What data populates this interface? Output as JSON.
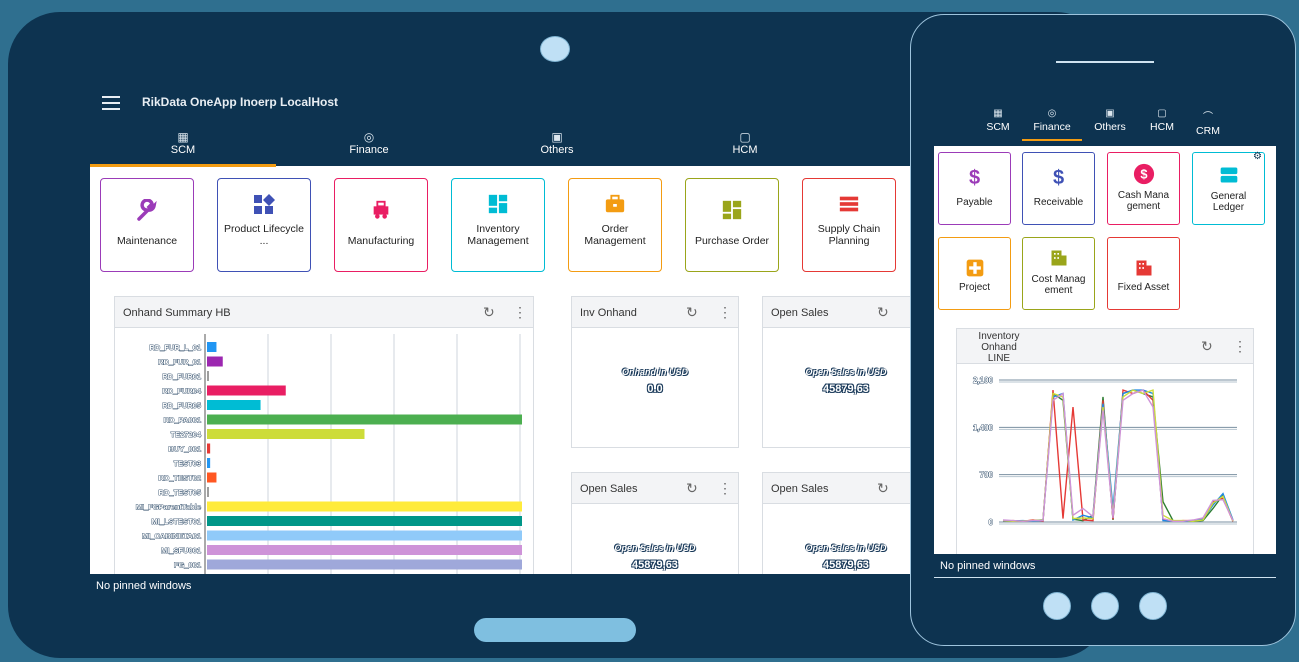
{
  "app": {
    "title": "RikData OneApp Inoerp LocalHost",
    "pinned": "No pinned windows"
  },
  "tabs": [
    {
      "label": "SCM",
      "icon": "building-icon"
    },
    {
      "label": "Finance",
      "icon": "globe-icon"
    },
    {
      "label": "Others",
      "icon": "others-icon"
    },
    {
      "label": "HCM",
      "icon": "person-icon"
    }
  ],
  "tiles": [
    {
      "label": "Maintenance",
      "color": "#9b3bb8",
      "icon": "wrench-icon"
    },
    {
      "label": "Product Lifecycle ...",
      "color": "#3f51b5",
      "icon": "shapes-icon"
    },
    {
      "label": "Manufacturing",
      "color": "#e91e63",
      "icon": "truck-icon"
    },
    {
      "label": "Inventory Management",
      "color": "#00bcd4",
      "icon": "grid-icon"
    },
    {
      "label": "Order Management",
      "color": "#f39c12",
      "icon": "briefcase-icon"
    },
    {
      "label": "Purchase Order",
      "color": "#9aa51a",
      "icon": "blocks-icon"
    },
    {
      "label": "Supply Chain Planning",
      "color": "#e53935",
      "icon": "bars-icon"
    }
  ],
  "onhand_panel": {
    "title": "Onhand Summary HB"
  },
  "kpis": [
    {
      "title": "Inv Onhand",
      "label": "Onhand in USD",
      "value": "0.0"
    },
    {
      "title": "Open Sales",
      "label": "Open Sales in USD",
      "value": "45879,63"
    },
    {
      "title": "Open Sales",
      "label": "Open Sales in USD",
      "value": "45879,63"
    },
    {
      "title": "Open Sales",
      "label": "Open Sales in USD",
      "value": "45879,63"
    }
  ],
  "chart_data": [
    {
      "type": "bar",
      "orientation": "horizontal",
      "title": "Onhand Summary HB",
      "categories": [
        "RD_FUR_L_01",
        "RD_FUR_01",
        "RD_FUR01",
        "RD_FUR04",
        "RD_FUR05",
        "RD_PA001",
        "TE27204",
        "BUY_001",
        "TEST03",
        "RD_TEST02",
        "RD_TEST05",
        "MI_FGParentTable",
        "MI_LSTEST01",
        "MI_CABINETA01",
        "MI_SFU001",
        "FG_001"
      ],
      "values": [
        3,
        5,
        0.2,
        25,
        17,
        100,
        50,
        1,
        1,
        3,
        0.3,
        100,
        100,
        100,
        100,
        100
      ],
      "colors": [
        "#2196f3",
        "#9c27b0",
        "#9e9e9e",
        "#e91e63",
        "#00bcd4",
        "#4caf50",
        "#cddc39",
        "#e53935",
        "#2196f3",
        "#ff5722",
        "#9e9e9e",
        "#ffeb3b",
        "#009688",
        "#90caf9",
        "#ce93d8",
        "#9fa8da"
      ]
    },
    {
      "type": "line",
      "title": "Inventory Onhand LINE",
      "ylim": [
        0,
        2100
      ],
      "yticks": [
        "0",
        "700",
        "1,400",
        "2,100"
      ],
      "series": [
        {
          "color": "#2e7d32",
          "values": [
            20,
            10,
            15,
            20,
            30,
            1900,
            1800,
            40,
            20,
            100,
            1850,
            30,
            1900,
            1950,
            1900,
            1850,
            300,
            20,
            10,
            10,
            20,
            200,
            400,
            20
          ]
        },
        {
          "color": "#e53935",
          "values": [
            10,
            20,
            10,
            30,
            10,
            1950,
            50,
            1700,
            30,
            20,
            1800,
            40,
            1950,
            1900,
            1950,
            1800,
            40,
            10,
            20,
            20,
            50,
            300,
            350,
            10
          ]
        },
        {
          "color": "#1e88e5",
          "values": [
            15,
            15,
            20,
            10,
            20,
            1850,
            1900,
            30,
            100,
            60,
            1750,
            200,
            1900,
            1950,
            1950,
            1900,
            20,
            15,
            10,
            15,
            40,
            250,
            420,
            30
          ]
        },
        {
          "color": "#cddc39",
          "values": [
            20,
            10,
            15,
            20,
            25,
            1900,
            1850,
            50,
            60,
            50,
            1700,
            100,
            1850,
            1950,
            1900,
            1950,
            100,
            20,
            20,
            10,
            30,
            280,
            380,
            15
          ]
        },
        {
          "color": "#ce93d8",
          "values": [
            30,
            20,
            10,
            20,
            20,
            1800,
            1900,
            100,
            200,
            80,
            1650,
            60,
            1800,
            1900,
            1950,
            1700,
            50,
            10,
            10,
            30,
            60,
            320,
            330,
            20
          ]
        }
      ]
    }
  ],
  "phone": {
    "tabs": [
      {
        "label": "SCM",
        "icon": "building-icon"
      },
      {
        "label": "Finance",
        "icon": "globe-icon"
      },
      {
        "label": "Others",
        "icon": "others-icon"
      },
      {
        "label": "HCM",
        "icon": "person-icon"
      },
      {
        "label": "CRM",
        "icon": "rainbow-icon"
      }
    ],
    "tiles": [
      {
        "label": "Payable",
        "color": "#9b3bb8",
        "icon": "dollar-icon"
      },
      {
        "label": "Receivable",
        "color": "#3f51b5",
        "icon": "dollar-icon"
      },
      {
        "label": "Cash Mana gement",
        "color": "#e91e63",
        "icon": "coin-icon"
      },
      {
        "label": "General Ledger",
        "color": "#00bcd4",
        "icon": "ledger-icon"
      },
      {
        "label": "Project",
        "color": "#f39c12",
        "icon": "project-icon"
      },
      {
        "label": "Cost Manag ement",
        "color": "#9aa51a",
        "icon": "building-icon"
      },
      {
        "label": "Fixed Asset",
        "color": "#e53935",
        "icon": "building-icon"
      }
    ],
    "chart_title": "Inventory Onhand LINE",
    "pinned": "No pinned windows"
  }
}
